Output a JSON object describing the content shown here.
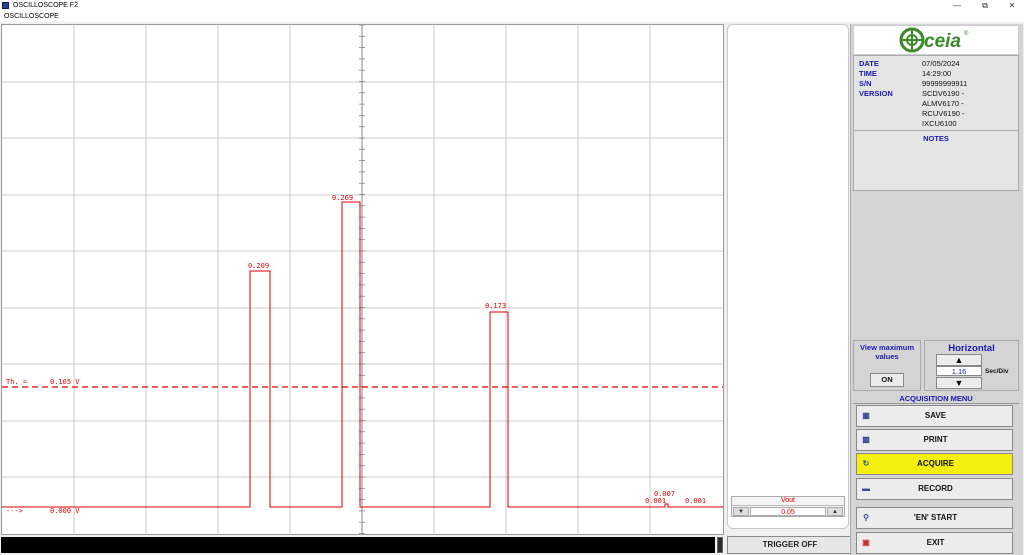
{
  "window": {
    "title": "OSCILLOSCOPE F2",
    "menu": "OSCILLOSCOPE",
    "controls": [
      "minimize",
      "restore",
      "close"
    ]
  },
  "scope": {
    "threshold_label": "Th. =",
    "threshold_value": "0.105 V",
    "zero_marker": "--->",
    "zero_value": "0.000 V",
    "peaks": [
      {
        "label": "0.209"
      },
      {
        "label": "0.269"
      },
      {
        "label": "0.173"
      },
      {
        "label": "0.007"
      },
      {
        "label": "0.001"
      },
      {
        "label": "0.001"
      }
    ],
    "trace_color": "#e00000",
    "grid_color": "#bdbdbd"
  },
  "vout": {
    "label": "Vout",
    "value": "0.05"
  },
  "trigger_button": "TRIGGER OFF",
  "info": {
    "date_label": "DATE",
    "date": "07/05/2024",
    "time_label": "TIME",
    "time": "14:29:00",
    "sn_label": "S/N",
    "sn": "99999999911",
    "version_label": "VERSION",
    "versions": [
      "SCDV6190 -",
      "ALMV6170 -",
      "RCUV6190 -",
      "IXCU6100"
    ],
    "notes_label": "NOTES"
  },
  "logo": {
    "text": "ceia",
    "registered": "®",
    "color": "#3a8a2a"
  },
  "view_max": {
    "title": "View maximum values",
    "state": "ON"
  },
  "horizontal": {
    "title": "Horizontal",
    "value": "1.16",
    "unit": "Sec/Div",
    "up_icon": "▲",
    "down_icon": "▼"
  },
  "acquisition_menu": {
    "title": "ACQUISITION MENU",
    "buttons": [
      {
        "label": "SAVE",
        "icon": "save-icon"
      },
      {
        "label": "PRINT",
        "icon": "printer-icon"
      },
      {
        "label": "ACQUIRE",
        "icon": "acquire-icon",
        "active": true
      },
      {
        "label": "RECORD",
        "icon": "record-icon"
      }
    ],
    "en_start": "'EN' START",
    "exit": "EXIT"
  }
}
